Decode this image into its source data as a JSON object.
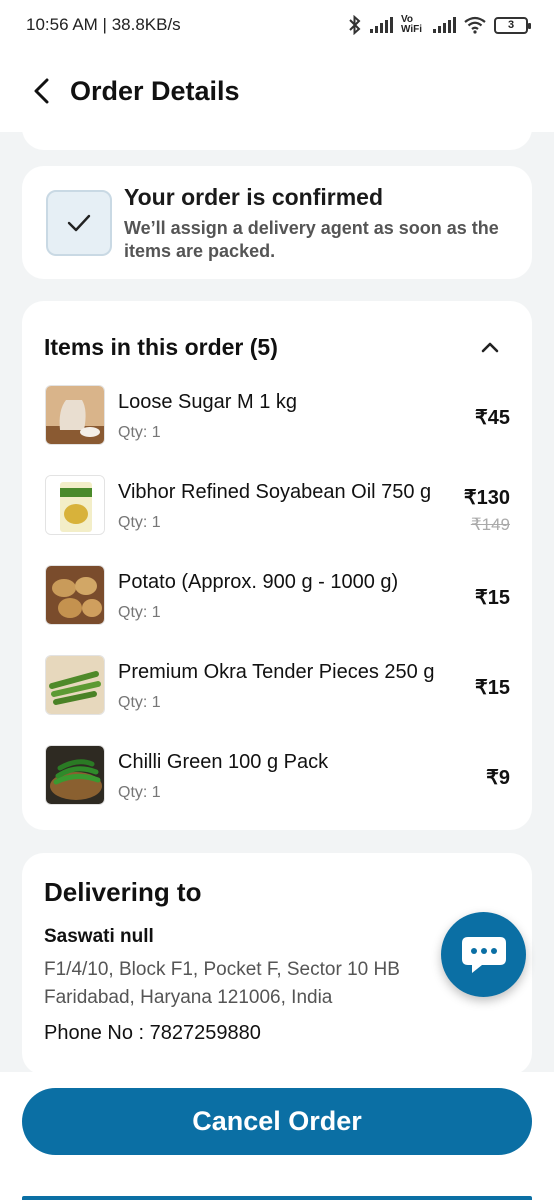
{
  "status_bar": {
    "time": "10:56 AM | 38.8KB/s",
    "vowifi": "Vo WiFi",
    "battery": "3"
  },
  "header": {
    "title": "Order Details"
  },
  "confirmation": {
    "title": "Your order is confirmed",
    "subtitle": "We’ll assign a delivery agent as soon as the items are packed."
  },
  "items_section": {
    "title": "Items in this order (5)",
    "items": [
      {
        "name": "Loose Sugar M 1 kg",
        "qty": "Qty: 1",
        "price": "₹45",
        "mrp": ""
      },
      {
        "name": "Vibhor Refined Soyabean Oil 750 g",
        "qty": "Qty: 1",
        "price": "₹130",
        "mrp": "₹149"
      },
      {
        "name": "Potato (Approx. 900 g - 1000 g)",
        "qty": "Qty: 1",
        "price": "₹15",
        "mrp": ""
      },
      {
        "name": "Premium Okra Tender Pieces 250 g",
        "qty": "Qty: 1",
        "price": "₹15",
        "mrp": ""
      },
      {
        "name": "Chilli Green 100 g Pack",
        "qty": "Qty: 1",
        "price": "₹9",
        "mrp": ""
      }
    ]
  },
  "delivery": {
    "title": "Delivering to",
    "name": "Saswati null",
    "address_line1": "F1/4/10, Block F1, Pocket F, Sector 10 HB",
    "address_line2": "Faridabad, Haryana 121006, India",
    "phone": "Phone No : 7827259880"
  },
  "actions": {
    "cancel_label": "Cancel Order"
  },
  "colors": {
    "accent": "#0b6fa4",
    "background": "#f2f4f5"
  }
}
